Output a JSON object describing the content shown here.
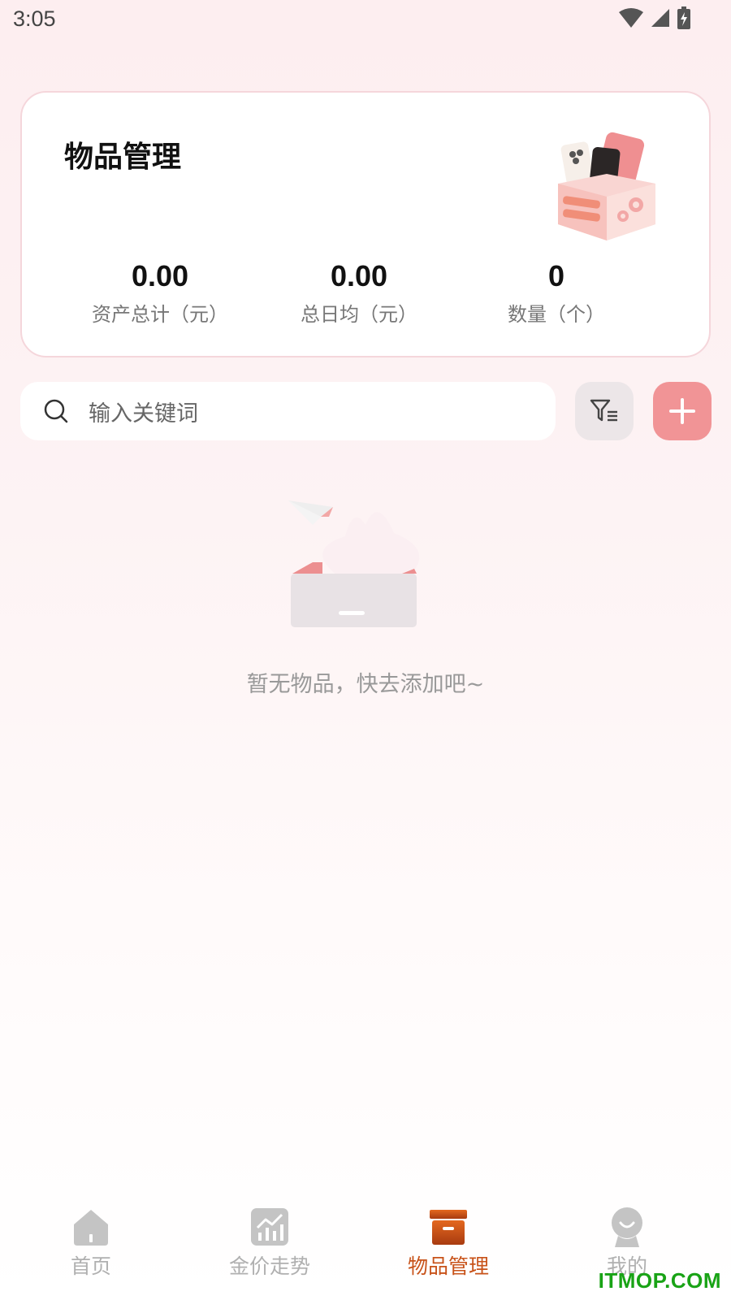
{
  "status_bar": {
    "time": "3:05"
  },
  "summary": {
    "title": "物品管理",
    "stats": [
      {
        "value": "0.00",
        "label": "资产总计（元）"
      },
      {
        "value": "0.00",
        "label": "总日均（元）"
      },
      {
        "value": "0",
        "label": "数量（个）"
      }
    ]
  },
  "search": {
    "placeholder": "输入关键词"
  },
  "empty_state": {
    "message": "暂无物品，快去添加吧~"
  },
  "tabs": [
    {
      "label": "首页",
      "icon": "home-icon",
      "active": false
    },
    {
      "label": "金价走势",
      "icon": "chart-icon",
      "active": false
    },
    {
      "label": "物品管理",
      "icon": "archive-box-icon",
      "active": true
    },
    {
      "label": "我的",
      "icon": "profile-icon",
      "active": false
    }
  ],
  "watermark": "ITMOP.COM",
  "colors": {
    "accent": "#f19496",
    "active_tab": "#c8531a",
    "inactive_tab": "#b0b0b0",
    "watermark": "#19a316"
  }
}
